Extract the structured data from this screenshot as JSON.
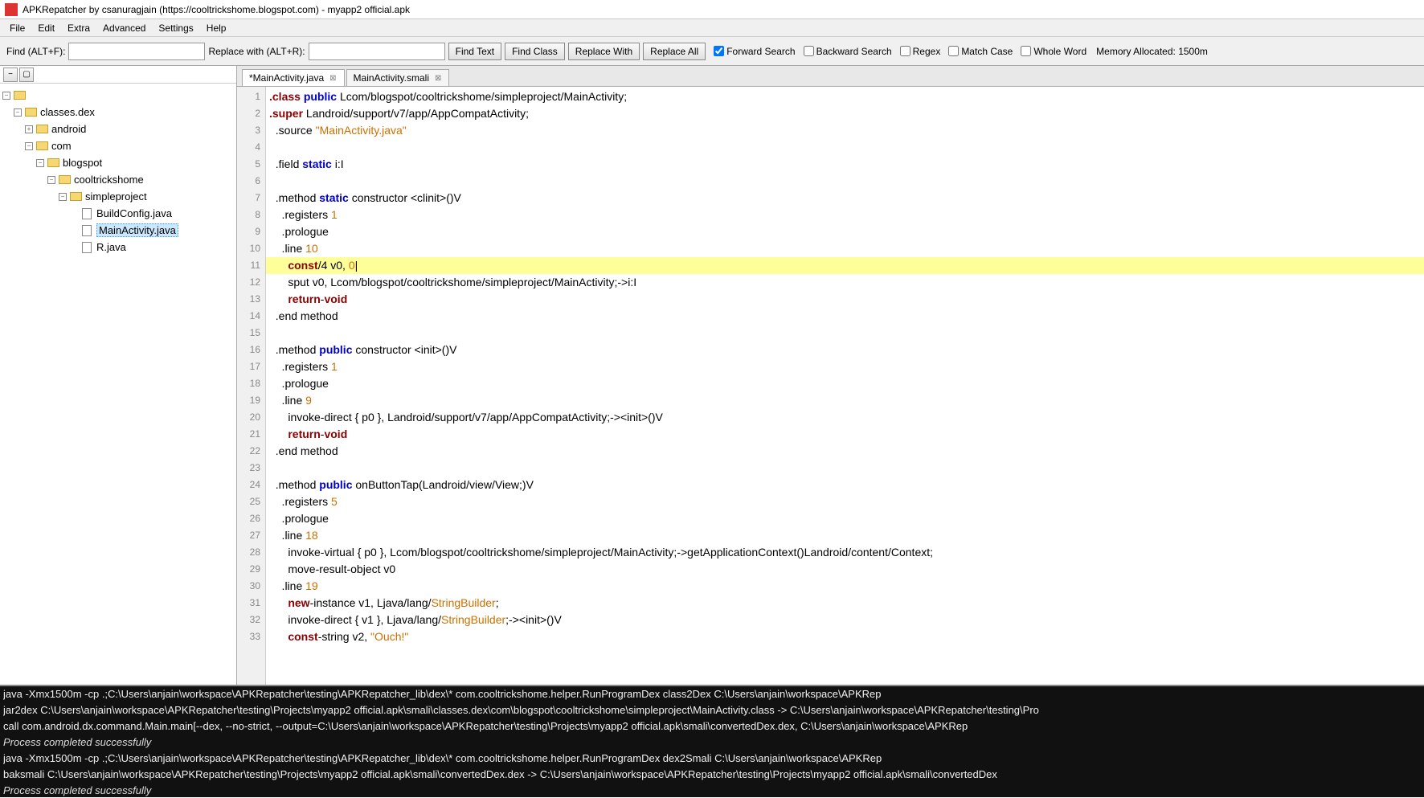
{
  "window": {
    "title": "APKRepatcher by csanuragjain (https://cooltrickshome.blogspot.com) - myapp2 official.apk"
  },
  "menu": {
    "items": [
      "File",
      "Edit",
      "Extra",
      "Advanced",
      "Settings",
      "Help"
    ]
  },
  "toolbar": {
    "find_label": "Find (ALT+F):",
    "replace_label": "Replace with (ALT+R):",
    "find_text_btn": "Find Text",
    "find_class_btn": "Find Class",
    "replace_with_btn": "Replace With",
    "replace_all_btn": "Replace All",
    "forward_search": "Forward Search",
    "backward_search": "Backward Search",
    "regex": "Regex",
    "match_case": "Match Case",
    "whole_word": "Whole Word",
    "memory": "Memory Allocated: 1500m",
    "forward_checked": true,
    "backward_checked": false,
    "regex_checked": false,
    "match_case_checked": false,
    "whole_word_checked": false
  },
  "tree": {
    "nodes": [
      {
        "depth": 0,
        "expanded": true,
        "icon": "expand",
        "label": "",
        "selected": false,
        "file": false,
        "hasToggle": true
      },
      {
        "depth": 1,
        "expanded": true,
        "icon": "folder",
        "label": "classes.dex",
        "selected": false,
        "file": false,
        "hasToggle": true
      },
      {
        "depth": 2,
        "expanded": false,
        "icon": "folder",
        "label": "android",
        "selected": false,
        "file": false,
        "hasToggle": true
      },
      {
        "depth": 2,
        "expanded": true,
        "icon": "folder",
        "label": "com",
        "selected": false,
        "file": false,
        "hasToggle": true
      },
      {
        "depth": 3,
        "expanded": true,
        "icon": "folder",
        "label": "blogspot",
        "selected": false,
        "file": false,
        "hasToggle": true
      },
      {
        "depth": 4,
        "expanded": true,
        "icon": "folder",
        "label": "cooltrickshome",
        "selected": false,
        "file": false,
        "hasToggle": true
      },
      {
        "depth": 5,
        "expanded": true,
        "icon": "folder",
        "label": "simpleproject",
        "selected": false,
        "file": false,
        "hasToggle": true
      },
      {
        "depth": 6,
        "expanded": false,
        "icon": "file",
        "label": "BuildConfig.java",
        "selected": false,
        "file": true,
        "hasToggle": false
      },
      {
        "depth": 6,
        "expanded": false,
        "icon": "file",
        "label": "MainActivity.java",
        "selected": true,
        "file": true,
        "hasToggle": false
      },
      {
        "depth": 6,
        "expanded": false,
        "icon": "file",
        "label": "R.java",
        "selected": false,
        "file": true,
        "hasToggle": false
      }
    ]
  },
  "tabs": [
    {
      "label": "*MainActivity.java",
      "active": true
    },
    {
      "label": "MainActivity.smali",
      "active": false
    }
  ],
  "code_lines": [
    {
      "n": 1,
      "hl": false,
      "tokens": [
        [
          "kw",
          ".class"
        ],
        [
          "",
          " "
        ],
        [
          "kw2",
          "public"
        ],
        [
          "",
          " Lcom/blogspot/cooltrickshome/simpleproject/MainActivity;"
        ]
      ]
    },
    {
      "n": 2,
      "hl": false,
      "tokens": [
        [
          "kw",
          ".super"
        ],
        [
          "",
          " Landroid/support/v7/app/AppCompatActivity;"
        ]
      ]
    },
    {
      "n": 3,
      "hl": false,
      "tokens": [
        [
          "",
          "  .source "
        ],
        [
          "str",
          "\"MainActivity.java\""
        ]
      ]
    },
    {
      "n": 4,
      "hl": false,
      "tokens": []
    },
    {
      "n": 5,
      "hl": false,
      "tokens": [
        [
          "",
          "  .field "
        ],
        [
          "kw2",
          "static"
        ],
        [
          "",
          " i:I"
        ]
      ]
    },
    {
      "n": 6,
      "hl": false,
      "tokens": []
    },
    {
      "n": 7,
      "hl": false,
      "tokens": [
        [
          "",
          "  .method "
        ],
        [
          "kw2",
          "static"
        ],
        [
          "",
          " constructor <clinit>()V"
        ]
      ]
    },
    {
      "n": 8,
      "hl": false,
      "tokens": [
        [
          "",
          "    .registers "
        ],
        [
          "num",
          "1"
        ]
      ]
    },
    {
      "n": 9,
      "hl": false,
      "tokens": [
        [
          "",
          "    .prologue"
        ]
      ]
    },
    {
      "n": 10,
      "hl": false,
      "tokens": [
        [
          "",
          "    .line "
        ],
        [
          "num",
          "10"
        ]
      ]
    },
    {
      "n": 11,
      "hl": true,
      "tokens": [
        [
          "",
          "      "
        ],
        [
          "kw",
          "const"
        ],
        [
          "",
          "/4 v0, "
        ],
        [
          "num",
          "0"
        ],
        [
          "",
          "|"
        ]
      ]
    },
    {
      "n": 12,
      "hl": false,
      "tokens": [
        [
          "",
          "      sput v0, Lcom/blogspot/cooltrickshome/simpleproject/MainActivity;->i:I"
        ]
      ]
    },
    {
      "n": 13,
      "hl": false,
      "tokens": [
        [
          "",
          "      "
        ],
        [
          "kw",
          "return"
        ],
        [
          "",
          "-"
        ],
        [
          "kw",
          "void"
        ]
      ]
    },
    {
      "n": 14,
      "hl": false,
      "tokens": [
        [
          "",
          "  .end method"
        ]
      ]
    },
    {
      "n": 15,
      "hl": false,
      "tokens": []
    },
    {
      "n": 16,
      "hl": false,
      "tokens": [
        [
          "",
          "  .method "
        ],
        [
          "kw2",
          "public"
        ],
        [
          "",
          " constructor <init>()V"
        ]
      ]
    },
    {
      "n": 17,
      "hl": false,
      "tokens": [
        [
          "",
          "    .registers "
        ],
        [
          "num",
          "1"
        ]
      ]
    },
    {
      "n": 18,
      "hl": false,
      "tokens": [
        [
          "",
          "    .prologue"
        ]
      ]
    },
    {
      "n": 19,
      "hl": false,
      "tokens": [
        [
          "",
          "    .line "
        ],
        [
          "num",
          "9"
        ]
      ]
    },
    {
      "n": 20,
      "hl": false,
      "tokens": [
        [
          "",
          "      invoke-direct { p0 }, Landroid/support/v7/app/AppCompatActivity;-><init>()V"
        ]
      ]
    },
    {
      "n": 21,
      "hl": false,
      "tokens": [
        [
          "",
          "      "
        ],
        [
          "kw",
          "return"
        ],
        [
          "",
          "-"
        ],
        [
          "kw",
          "void"
        ]
      ]
    },
    {
      "n": 22,
      "hl": false,
      "tokens": [
        [
          "",
          "  .end method"
        ]
      ]
    },
    {
      "n": 23,
      "hl": false,
      "tokens": []
    },
    {
      "n": 24,
      "hl": false,
      "tokens": [
        [
          "",
          "  .method "
        ],
        [
          "kw2",
          "public"
        ],
        [
          "",
          " onButtonTap(Landroid/view/View;)V"
        ]
      ]
    },
    {
      "n": 25,
      "hl": false,
      "tokens": [
        [
          "",
          "    .registers "
        ],
        [
          "num",
          "5"
        ]
      ]
    },
    {
      "n": 26,
      "hl": false,
      "tokens": [
        [
          "",
          "    .prologue"
        ]
      ]
    },
    {
      "n": 27,
      "hl": false,
      "tokens": [
        [
          "",
          "    .line "
        ],
        [
          "num",
          "18"
        ]
      ]
    },
    {
      "n": 28,
      "hl": false,
      "tokens": [
        [
          "",
          "      invoke-virtual { p0 }, Lcom/blogspot/cooltrickshome/simpleproject/MainActivity;->getApplicationContext()Landroid/content/Context;"
        ]
      ]
    },
    {
      "n": 29,
      "hl": false,
      "tokens": [
        [
          "",
          "      move-result-object v0"
        ]
      ]
    },
    {
      "n": 30,
      "hl": false,
      "tokens": [
        [
          "",
          "    .line "
        ],
        [
          "num",
          "19"
        ]
      ]
    },
    {
      "n": 31,
      "hl": false,
      "tokens": [
        [
          "",
          "      "
        ],
        [
          "kw",
          "new"
        ],
        [
          "",
          "-instance v1, Ljava/lang/"
        ],
        [
          "typ",
          "StringBuilder"
        ],
        [
          "",
          ";"
        ]
      ]
    },
    {
      "n": 32,
      "hl": false,
      "tokens": [
        [
          "",
          "      invoke-direct { v1 }, Ljava/lang/"
        ],
        [
          "typ",
          "StringBuilder"
        ],
        [
          "",
          ";-><init>()V"
        ]
      ]
    },
    {
      "n": 33,
      "hl": false,
      "tokens": [
        [
          "",
          "      "
        ],
        [
          "kw",
          "const"
        ],
        [
          "",
          "-string v2, "
        ],
        [
          "str",
          "\"Ouch!\""
        ]
      ]
    }
  ],
  "console": [
    {
      "italic": false,
      "text": "java -Xmx1500m -cp .;C:\\Users\\anjain\\workspace\\APKRepatcher\\testing\\APKRepatcher_lib\\dex\\* com.cooltrickshome.helper.RunProgramDex class2Dex C:\\Users\\anjain\\workspace\\APKRep"
    },
    {
      "italic": false,
      "text": "jar2dex C:\\Users\\anjain\\workspace\\APKRepatcher\\testing\\Projects\\myapp2 official.apk\\smali\\classes.dex\\com\\blogspot\\cooltrickshome\\simpleproject\\MainActivity.class -> C:\\Users\\anjain\\workspace\\APKRepatcher\\testing\\Pro"
    },
    {
      "italic": false,
      "text": "call com.android.dx.command.Main.main[--dex, --no-strict, --output=C:\\Users\\anjain\\workspace\\APKRepatcher\\testing\\Projects\\myapp2 official.apk\\smali\\convertedDex.dex, C:\\Users\\anjain\\workspace\\APKRep"
    },
    {
      "italic": true,
      "text": "Process completed successfully"
    },
    {
      "italic": false,
      "text": "java -Xmx1500m -cp .;C:\\Users\\anjain\\workspace\\APKRepatcher\\testing\\APKRepatcher_lib\\dex\\* com.cooltrickshome.helper.RunProgramDex dex2Smali C:\\Users\\anjain\\workspace\\APKRep"
    },
    {
      "italic": false,
      "text": "baksmali C:\\Users\\anjain\\workspace\\APKRepatcher\\testing\\Projects\\myapp2 official.apk\\smali\\convertedDex.dex -> C:\\Users\\anjain\\workspace\\APKRepatcher\\testing\\Projects\\myapp2 official.apk\\smali\\convertedDex"
    },
    {
      "italic": true,
      "text": "Process completed successfully"
    }
  ]
}
